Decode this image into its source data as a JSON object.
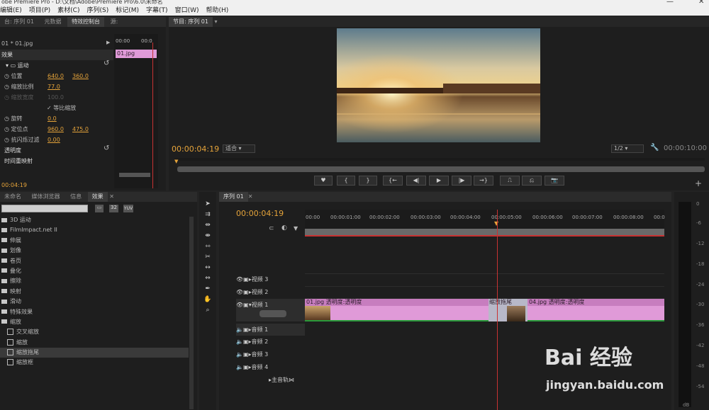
{
  "window": {
    "title": "obe Premiere Pro - D:\\文档\\Adobe\\Premiere Pro\\6.0\\未命名"
  },
  "menu": [
    "编辑(E)",
    "项目(P)",
    "素材(C)",
    "序列(S)",
    "标记(M)",
    "字幕(T)",
    "窗口(W)",
    "帮助(H)"
  ],
  "effect_controls": {
    "tabs": [
      "台: 序列 01",
      "元数据",
      "特效控制台",
      "源:"
    ],
    "clip_name": "01 * 01.jpg",
    "mini_ruler": [
      "00:00",
      "00:0"
    ],
    "mini_clip": "01.jpg",
    "section": "效果",
    "motion": "运动",
    "props": [
      {
        "label": "位置",
        "v1": "640.0",
        "v2": "360.0"
      },
      {
        "label": "缩放比例",
        "v1": "77.0",
        "v2": ""
      },
      {
        "label": "缩放宽度",
        "v1": "100.0",
        "v2": ""
      },
      {
        "label": "等比缩放",
        "v1": "",
        "v2": ""
      },
      {
        "label": "旋转",
        "v1": "0.0",
        "v2": ""
      },
      {
        "label": "定位点",
        "v1": "960.0",
        "v2": "475.0"
      },
      {
        "label": "抗闪烁过滤",
        "v1": "0.00",
        "v2": ""
      }
    ],
    "opacity": "透明度",
    "time_remap": "时间重映射",
    "timecode": "00:04:19"
  },
  "program": {
    "tab": "节目: 序列 01",
    "timecode": "00:00:04:19",
    "fit": "适合",
    "quality": "1/2",
    "duration": "00:00:10:00"
  },
  "project": {
    "tabs": [
      "未命名",
      "媒体浏览器",
      "信息",
      "效果"
    ],
    "buttons": [
      "32",
      "YUV"
    ],
    "items": [
      {
        "label": "3D 运动",
        "type": "folder"
      },
      {
        "label": "FilmImpact.net II",
        "type": "folder"
      },
      {
        "label": "伸展",
        "type": "folder"
      },
      {
        "label": "划像",
        "type": "folder"
      },
      {
        "label": "卷页",
        "type": "folder"
      },
      {
        "label": "叠化",
        "type": "folder"
      },
      {
        "label": "擦除",
        "type": "folder"
      },
      {
        "label": "映射",
        "type": "folder"
      },
      {
        "label": "滑动",
        "type": "folder"
      },
      {
        "label": "特殊效果",
        "type": "folder"
      },
      {
        "label": "缩放",
        "type": "folder"
      },
      {
        "label": "交叉缩放",
        "type": "fx"
      },
      {
        "label": "缩放",
        "type": "fx"
      },
      {
        "label": "缩放拖尾",
        "type": "fx"
      },
      {
        "label": "缩放框",
        "type": "fx"
      }
    ]
  },
  "timeline": {
    "tab": "序列 01",
    "timecode": "00:00:04:19",
    "ruler": [
      "00:00",
      "00:00:01:00",
      "00:00:02:00",
      "00:00:03:00",
      "00:00:04:00",
      "00:00:05:00",
      "00:00:06:00",
      "00:00:07:00",
      "00:00:08:00",
      "00:0"
    ],
    "video_tracks": [
      "视频 3",
      "视频 2",
      "视频 1"
    ],
    "audio_tracks": [
      "音频 1",
      "音频 2",
      "音频 3",
      "音频 4"
    ],
    "master": "主音轨",
    "clip1": "01.jpg  透明度:透明度",
    "transition": "缩放拖尾",
    "clip2": "04.jpg  透明度:透明度"
  },
  "meter_labels": [
    "0",
    "-6",
    "-12",
    "-18",
    "-24",
    "-30",
    "-36",
    "-42",
    "-48",
    "-54",
    "dB"
  ],
  "watermark": {
    "brand": "Bai 经验",
    "url": "jingyan.baidu.com"
  }
}
